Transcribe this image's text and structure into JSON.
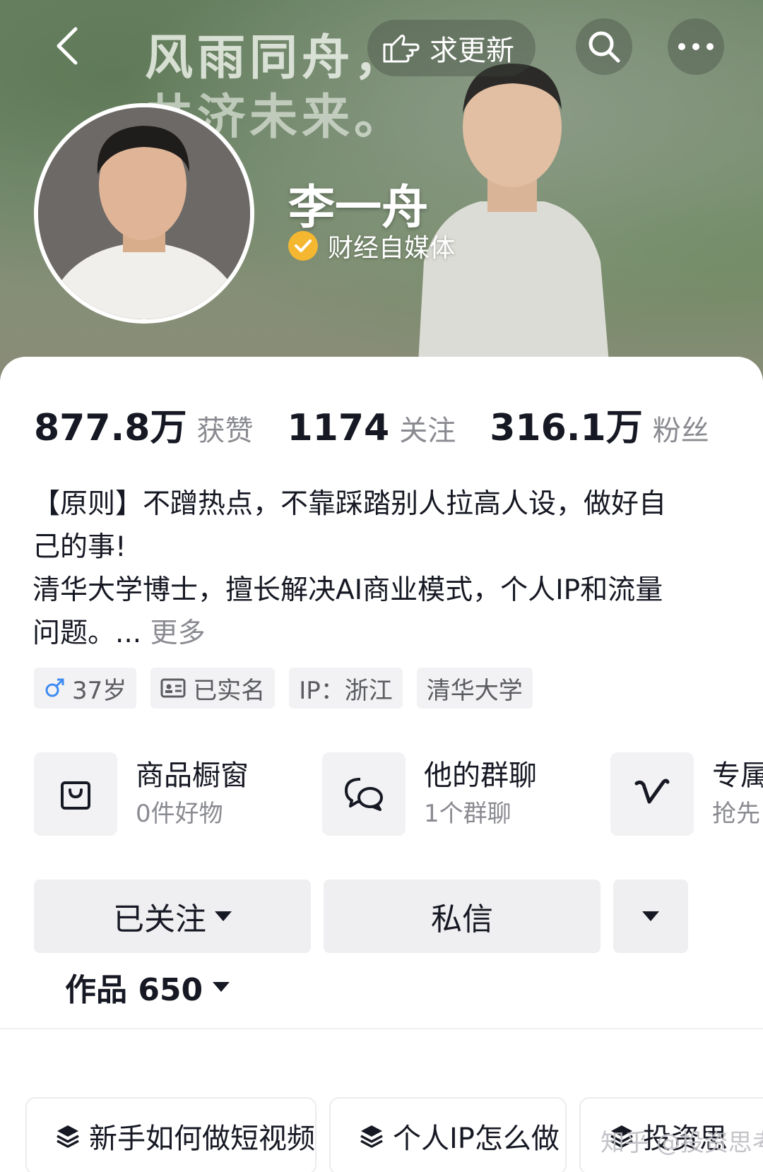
{
  "cover": {
    "slogan_line1": "风雨同舟，",
    "slogan_line2": "共济未来。"
  },
  "topbar": {
    "back_icon": "back-arrow-icon",
    "update_label": "求更新",
    "update_icon": "pointing-hand-icon",
    "search_icon": "search-icon",
    "more_icon": "more-dots-icon"
  },
  "profile": {
    "name": "李一舟",
    "verify_label": "财经自媒体",
    "verify_color": "#f6b730"
  },
  "stats": [
    {
      "num": "877.8万",
      "label": "获赞"
    },
    {
      "num": "1174",
      "label": "关注"
    },
    {
      "num": "316.1万",
      "label": "粉丝"
    }
  ],
  "bio": {
    "line1": "【原则】不蹭热点，不靠踩踏别人拉高人设，做好自",
    "line2": "己的事!",
    "line3": "清华大学博士，擅长解决AI商业模式，个人IP和流量",
    "line4": "问题。...",
    "more": "更多"
  },
  "tags": [
    {
      "icon": "male-icon",
      "label": "37岁"
    },
    {
      "icon": "id-card-icon",
      "label": "已实名"
    },
    {
      "icon": "",
      "label": "IP：浙江"
    },
    {
      "icon": "",
      "label": "清华大学"
    }
  ],
  "services": [
    {
      "icon": "shopping-bag-icon",
      "title": "商品橱窗",
      "sub": "0件好物"
    },
    {
      "icon": "group-chat-icon",
      "title": "他的群聊",
      "sub": "1个群聊"
    },
    {
      "icon": "vip-v-icon",
      "title": "专属",
      "sub": "抢先"
    }
  ],
  "actions": {
    "follow_label": "已关注",
    "message_label": "私信"
  },
  "works": {
    "label": "作品 650"
  },
  "collections": [
    {
      "icon": "layers-icon",
      "label": "新手如何做短视频"
    },
    {
      "icon": "layers-icon",
      "label": "个人IP怎么做"
    },
    {
      "icon": "layers-icon",
      "label": "投资思"
    }
  ],
  "watermark": "知乎 @投资思考"
}
